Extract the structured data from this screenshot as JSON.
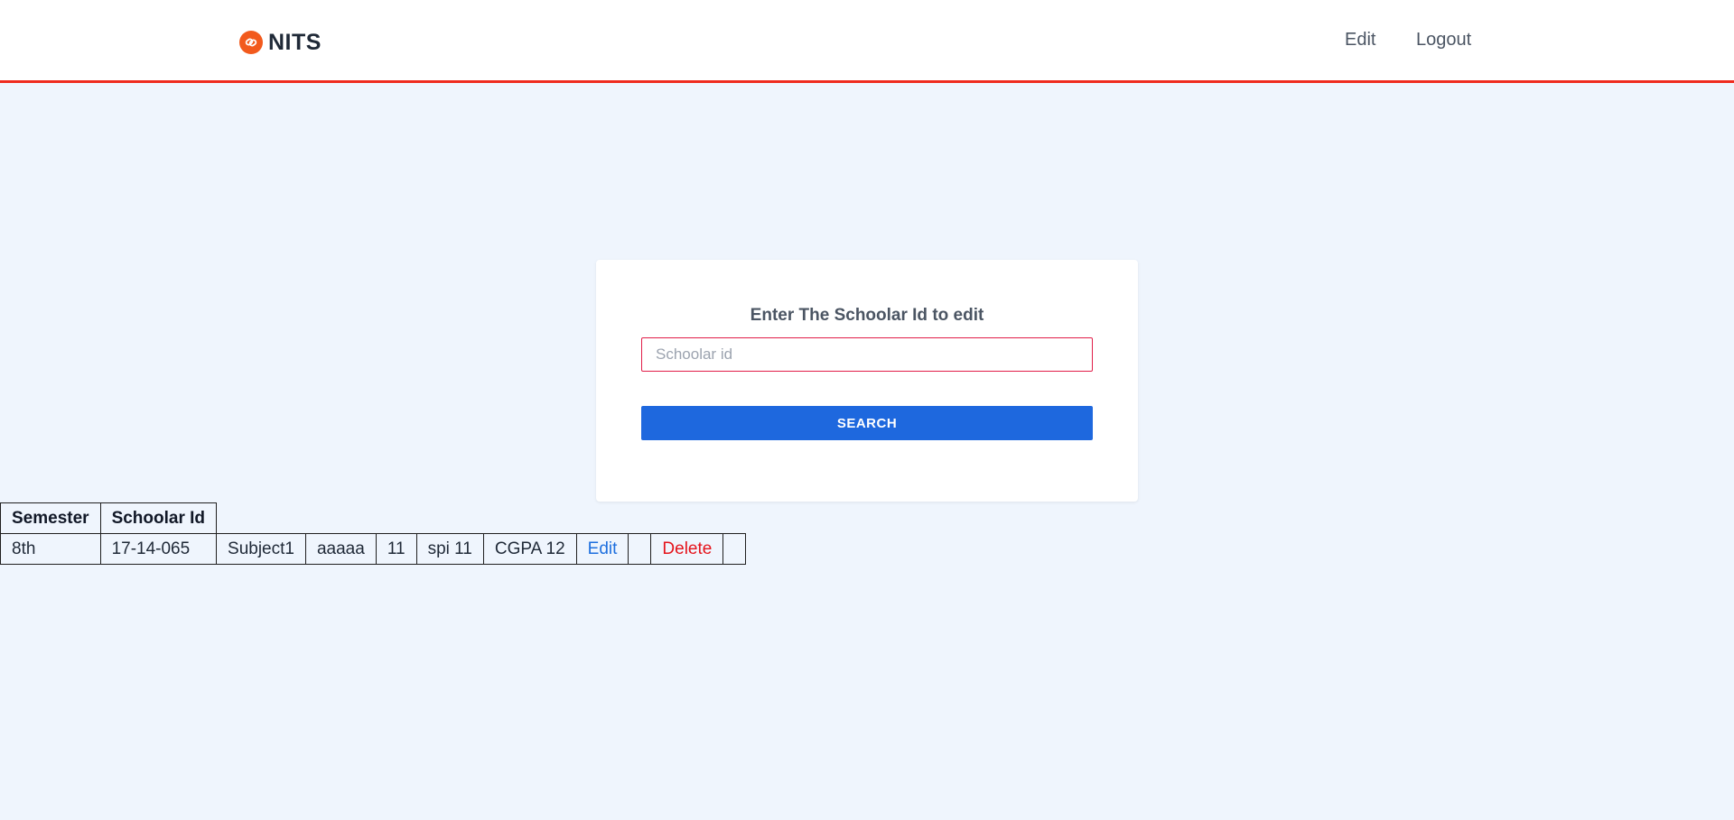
{
  "header": {
    "brand": "NITS",
    "nav": {
      "edit_label": "Edit",
      "logout_label": "Logout"
    },
    "accent_color": "#ef2b1e",
    "logo_color": "#f25a1d"
  },
  "search_card": {
    "title": "Enter The Schoolar Id to edit",
    "input_placeholder": "Schoolar id",
    "input_value": "",
    "button_label": "SEARCH",
    "button_color": "#1e68de"
  },
  "results_table": {
    "headers": [
      "Semester",
      "Schoolar Id"
    ],
    "rows": [
      {
        "semester": "8th",
        "scholar_id": "17-14-065",
        "subject": "Subject1",
        "name": "aaaaa",
        "value": "11",
        "spi": "spi 11",
        "cgpa": "CGPA 12",
        "edit_label": "Edit",
        "empty_1": "",
        "delete_label": "Delete",
        "empty_2": ""
      }
    ]
  }
}
